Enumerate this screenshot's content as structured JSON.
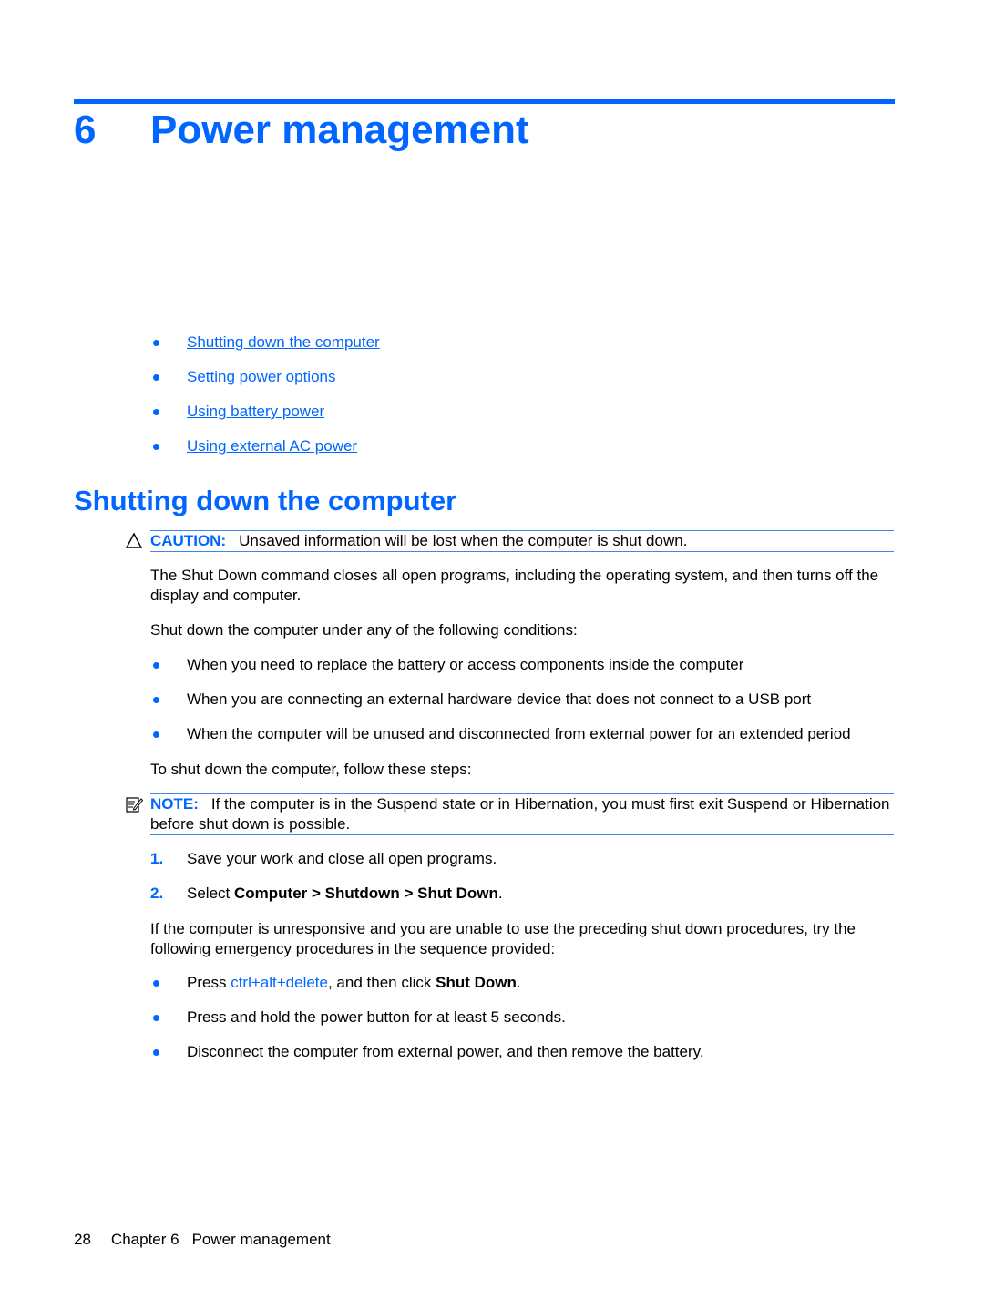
{
  "chapter": {
    "number": "6",
    "title": "Power management"
  },
  "toc": [
    "Shutting down the computer",
    "Setting power options",
    "Using battery power",
    "Using external AC power"
  ],
  "section": {
    "title": "Shutting down the computer"
  },
  "caution": {
    "label": "CAUTION:",
    "text": "Unsaved information will be lost when the computer is shut down."
  },
  "paragraphs": {
    "intro": "The Shut Down command closes all open programs, including the operating system, and then turns off the display and computer.",
    "conditions_intro": "Shut down the computer under any of the following conditions:",
    "steps_intro": "To shut down the computer, follow these steps:",
    "emergency_intro": "If the computer is unresponsive and you are unable to use the preceding shut down procedures, try the following emergency procedures in the sequence provided:"
  },
  "conditions": [
    "When you need to replace the battery or access components inside the computer",
    "When you are connecting an external hardware device that does not connect to a USB port",
    "When the computer will be unused and disconnected from external power for an extended period"
  ],
  "note": {
    "label": "NOTE:",
    "text": "If the computer is in the Suspend state or in Hibernation, you must first exit Suspend or Hibernation before shut down is possible."
  },
  "steps": [
    {
      "num": "1.",
      "text": "Save your work and close all open programs."
    },
    {
      "num": "2.",
      "prefix": "Select ",
      "bold": "Computer > Shutdown > Shut Down",
      "suffix": "."
    }
  ],
  "emergency": {
    "item1": {
      "prefix": "Press ",
      "key": "ctrl+alt+delete",
      "middle": ", and then click ",
      "bold": "Shut Down",
      "suffix": "."
    },
    "item2": "Press and hold the power button for at least 5 seconds.",
    "item3": "Disconnect the computer from external power, and then remove the battery."
  },
  "footer": {
    "page_number": "28",
    "chapter_label": "Chapter 6",
    "chapter_title": "Power management"
  }
}
